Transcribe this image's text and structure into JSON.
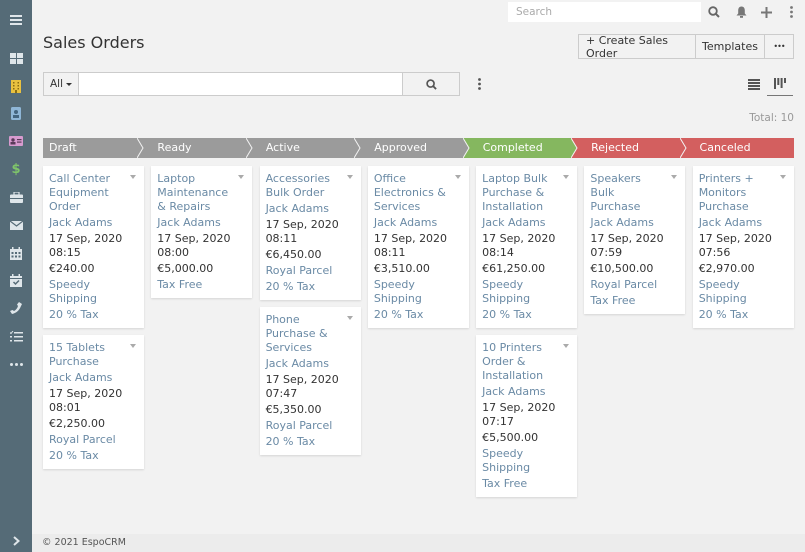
{
  "app": {
    "name": "EspoCRM"
  },
  "sidebar": {
    "items": [
      {
        "name": "menu-toggle",
        "icon": "hamburger-icon"
      },
      {
        "name": "home",
        "icon": "dashboard-icon"
      },
      {
        "name": "accounts",
        "icon": "building-icon"
      },
      {
        "name": "contacts",
        "icon": "id-badge-icon"
      },
      {
        "name": "leads",
        "icon": "id-card-icon"
      },
      {
        "name": "opportunities",
        "icon": "dollar-icon"
      },
      {
        "name": "cases",
        "icon": "briefcase-icon"
      },
      {
        "name": "emails",
        "icon": "envelope-icon"
      },
      {
        "name": "calendar",
        "icon": "calendar-icon"
      },
      {
        "name": "meetings",
        "icon": "calendar-check-icon"
      },
      {
        "name": "calls",
        "icon": "phone-icon"
      },
      {
        "name": "tasks",
        "icon": "tasks-icon"
      },
      {
        "name": "more",
        "icon": "ellipsis-icon"
      }
    ],
    "expand_icon": "chevron-right-icon"
  },
  "topbar": {
    "search_placeholder": "Search",
    "icons": [
      "search-icon",
      "bell-icon",
      "plus-icon",
      "kebab-icon"
    ]
  },
  "header": {
    "title": "Sales Orders",
    "create_label": "+ Create Sales Order",
    "templates_label": "Templates",
    "more_label": "•••"
  },
  "search": {
    "filter_label": "All",
    "value": "",
    "placeholder": ""
  },
  "view": {
    "modes": [
      "list",
      "kanban"
    ],
    "active": "kanban"
  },
  "total_label": "Total: 10",
  "stages": [
    {
      "label": "Draft",
      "color": "#9b9b9b"
    },
    {
      "label": "Ready",
      "color": "#9b9b9b"
    },
    {
      "label": "Active",
      "color": "#9b9b9b"
    },
    {
      "label": "Approved",
      "color": "#9b9b9b"
    },
    {
      "label": "Completed",
      "color": "#85b75f"
    },
    {
      "label": "Rejected",
      "color": "#d35f5f"
    },
    {
      "label": "Canceled",
      "color": "#d35f5f"
    }
  ],
  "columns": [
    [
      {
        "title": "Call Center Equipment Order",
        "person": "Jack Adams",
        "date": "17 Sep, 2020",
        "time": "08:15",
        "amount": "€240.00",
        "shipping": "Speedy Shipping",
        "tax": "20 % Tax"
      },
      {
        "title": "15 Tablets Purchase",
        "person": "Jack Adams",
        "date": "17 Sep, 2020",
        "time": "08:01",
        "amount": "€2,250.00",
        "shipping": "Royal Parcel",
        "tax": "20 % Tax"
      }
    ],
    [
      {
        "title": "Laptop Maintenance & Repairs",
        "person": "Jack Adams",
        "date": "17 Sep, 2020",
        "time": "08:00",
        "amount": "€5,000.00",
        "shipping": "",
        "tax": "Tax Free"
      }
    ],
    [
      {
        "title": "Accessories Bulk Order",
        "person": "Jack Adams",
        "date": "17 Sep, 2020",
        "time": "08:11",
        "amount": "€6,450.00",
        "shipping": "Royal Parcel",
        "tax": "20 % Tax"
      },
      {
        "title": "Phone Purchase & Services",
        "person": "Jack Adams",
        "date": "17 Sep, 2020",
        "time": "07:47",
        "amount": "€5,350.00",
        "shipping": "Royal Parcel",
        "tax": "20 % Tax"
      }
    ],
    [
      {
        "title": "Office Electronics & Services",
        "person": "Jack Adams",
        "date": "17 Sep, 2020",
        "time": "08:11",
        "amount": "€3,510.00",
        "shipping": "Speedy Shipping",
        "tax": "20 % Tax"
      }
    ],
    [
      {
        "title": "Laptop Bulk Purchase & Installation",
        "person": "Jack Adams",
        "date": "17 Sep, 2020",
        "time": "08:14",
        "amount": "€61,250.00",
        "shipping": "Speedy Shipping",
        "tax": "20 % Tax"
      },
      {
        "title": "10 Printers Order & Installation",
        "person": "Jack Adams",
        "date": "17 Sep, 2020",
        "time": "07:17",
        "amount": "€5,500.00",
        "shipping": "Speedy Shipping",
        "tax": "Tax Free"
      }
    ],
    [
      {
        "title": "Speakers Bulk Purchase",
        "person": "Jack Adams",
        "date": "17 Sep, 2020",
        "time": "07:59",
        "amount": "€10,500.00",
        "shipping": "Royal Parcel",
        "tax": "Tax Free"
      }
    ],
    [
      {
        "title": "Printers + Monitors Purchase",
        "person": "Jack Adams",
        "date": "17 Sep, 2020",
        "time": "07:56",
        "amount": "€2,970.00",
        "shipping": "Speedy Shipping",
        "tax": "20 % Tax"
      }
    ]
  ],
  "footer": {
    "text": "© 2021 EspoCRM"
  }
}
